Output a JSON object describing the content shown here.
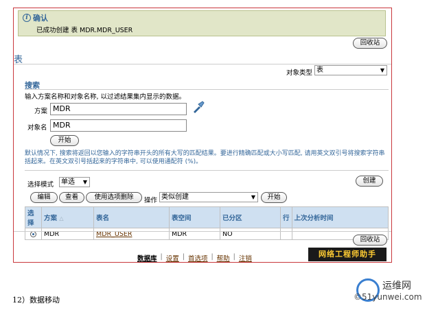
{
  "confirmation": {
    "title": "确认",
    "message": "已成功创建 表 MDR.MDR_USER"
  },
  "recycle_bin_label": "回收站",
  "page_heading": "表",
  "object_type": {
    "label": "对象类型",
    "value": "表"
  },
  "search": {
    "title": "搜索",
    "instructions": "输入方案名称和对象名称, 以过滤结果集内显示的数据。",
    "schema_label": "方案",
    "schema_value": "MDR",
    "object_name_label": "对象名",
    "object_name_value": "MDR",
    "go_label": "开始",
    "note": "默认情况下, 搜索将返回以您输入的字符串开头的所有大写的匹配结果。要进行精确匹配或大小写匹配, 请用英文双引号将搜索字符串括起来。在英文双引号括起来的字符串中, 可以使用通配符 (%)。"
  },
  "selection": {
    "mode_label": "选择模式",
    "mode_value": "单选",
    "create_label": "创建"
  },
  "actions": {
    "edit": "编辑",
    "view": "查看",
    "delete_with_options": "使用选项删除",
    "operation_label": "操作",
    "operation_value": "类似创建",
    "go": "开始"
  },
  "table": {
    "headers": [
      "选择",
      "方案",
      "表名",
      "表空间",
      "已分区",
      "行",
      "上次分析时间"
    ],
    "rows": [
      {
        "schema": "MDR",
        "table_name": "MDR_USER",
        "tablespace": "MDR",
        "partitioned": "NO",
        "rows": "",
        "last_analyzed": ""
      }
    ]
  },
  "footer": {
    "links": [
      "数据库",
      "设置",
      "首选项",
      "帮助",
      "注销"
    ],
    "badge": "网络工程师助手"
  },
  "caption": "12）数据移动",
  "watermark": {
    "line1": "运维网",
    "line2": "©51yunwei.com"
  },
  "colors": {
    "accent": "#336699",
    "frame_border": "#c8363b",
    "confirm_bg": "#e1e6c8",
    "header_bg": "#cfe0f1"
  }
}
